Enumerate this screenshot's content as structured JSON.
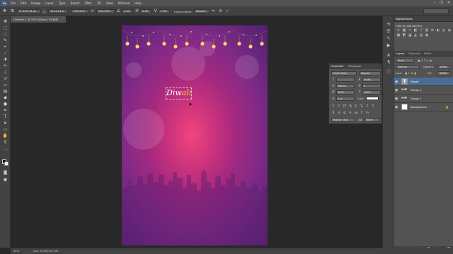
{
  "app": {
    "logo": "Ps",
    "menus": [
      "File",
      "Edit",
      "Image",
      "Layer",
      "Type",
      "Select",
      "Filter",
      "3D",
      "View",
      "Window",
      "Help"
    ],
    "window_controls": [
      "minimize-icon",
      "restore-icon",
      "close-icon"
    ]
  },
  "options_bar": {
    "x_value": "X: 553.74 px",
    "y_value": "1112.51 p",
    "w_value": "100.00%",
    "h_value": "100.00%",
    "angle_value": "0.00",
    "hskew_value": "0.00",
    "vskew_value": "0.00",
    "interpolation_label": "Interpolation:",
    "interpolation_value": "Bicubic",
    "workspace": "Photography"
  },
  "document": {
    "tab_title": "Untitled-1 @ 25% (Diwali, RGB/8)",
    "zoom": "25%",
    "doc_info": "Doc: 24.9M/221.0M",
    "artwork_text_main": "Diw",
    "artwork_text_accent": "ali"
  },
  "character_panel": {
    "tabs": [
      "Character",
      "Paragraph"
    ],
    "font_family": "Great Vibes",
    "font_style": "Regular",
    "size": "",
    "leading": "(Auto)",
    "tracking": "0",
    "kerning": "Metrics",
    "scale_v": "100%",
    "scale_h": "100%",
    "baseline": "0 pt",
    "color_label": "Color:",
    "language": "English: USA",
    "antialias": "Sharp"
  },
  "adjustments_panel": {
    "tab": "Adjustments",
    "title": "Add an adjustment",
    "icons": [
      "brightness-icon",
      "levels-icon",
      "curves-icon",
      "exposure-icon",
      "vibrance-icon",
      "hue-icon",
      "color-balance-icon",
      "bw-icon",
      "photo-filter-icon",
      "channel-mixer-icon",
      "lookup-icon",
      "invert-icon",
      "posterize-icon",
      "threshold-icon",
      "gradient-map-icon",
      "selective-color-icon"
    ]
  },
  "layers_panel": {
    "tabs": [
      "Layers",
      "Channels",
      "Paths"
    ],
    "kind_filter": "Kind",
    "blend_mode": "Normal",
    "opacity_label": "Opacity:",
    "opacity_value": "100%",
    "lock_label": "Lock:",
    "fill_label": "Fill:",
    "fill_value": "100%",
    "layers": [
      {
        "name": "Diwali",
        "type": "text",
        "active": true
      },
      {
        "name": "Group 2",
        "type": "group",
        "active": false
      },
      {
        "name": "Group 1",
        "type": "group",
        "active": false
      },
      {
        "name": "Background",
        "type": "background",
        "active": false
      }
    ]
  },
  "colors": {
    "ui_dark": "#282828",
    "panel": "#535353",
    "panel_header": "#424242",
    "selection_blue": "#4b6d94",
    "artwork_pink": "#f0457f",
    "artwork_purple": "#532072",
    "text_gold": "#ffc33d"
  }
}
